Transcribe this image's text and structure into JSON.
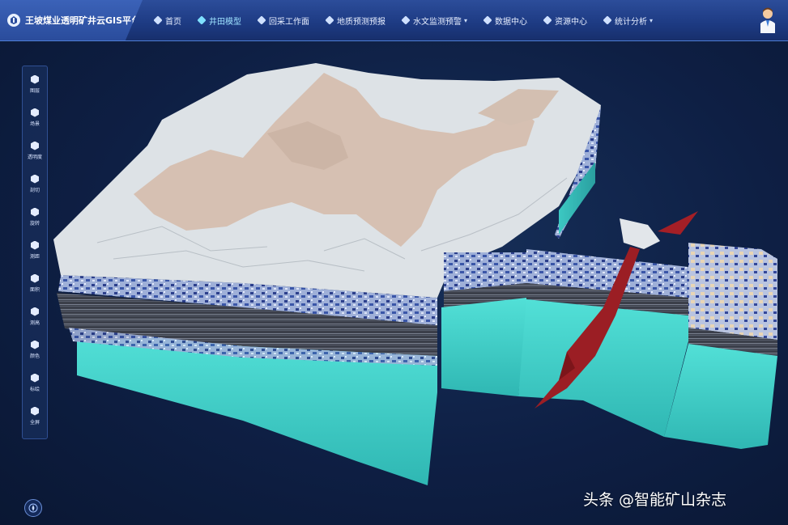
{
  "header": {
    "title": "王坡煤业透明矿井云GIS平台",
    "nav": [
      {
        "label": "首页",
        "active": false,
        "dropdown": false
      },
      {
        "label": "井田模型",
        "active": true,
        "dropdown": false
      },
      {
        "label": "回采工作面",
        "active": false,
        "dropdown": false
      },
      {
        "label": "地质预测预报",
        "active": false,
        "dropdown": false
      },
      {
        "label": "水文监测预警",
        "active": false,
        "dropdown": true
      },
      {
        "label": "数据中心",
        "active": false,
        "dropdown": false
      },
      {
        "label": "资源中心",
        "active": false,
        "dropdown": false
      },
      {
        "label": "统计分析",
        "active": false,
        "dropdown": true
      }
    ]
  },
  "toolbar": {
    "items": [
      {
        "label": "图层",
        "icon": "layers-icon"
      },
      {
        "label": "场景",
        "icon": "scene-icon"
      },
      {
        "label": "透明度",
        "icon": "transparency-icon"
      },
      {
        "label": "剖切",
        "icon": "section-cut-icon"
      },
      {
        "label": "旋转",
        "icon": "rotate-icon"
      },
      {
        "label": "测距",
        "icon": "distance-icon"
      },
      {
        "label": "面积",
        "icon": "area-icon"
      },
      {
        "label": "测高",
        "icon": "height-icon"
      },
      {
        "label": "颜色",
        "icon": "color-icon"
      },
      {
        "label": "标绘",
        "icon": "plot-icon"
      },
      {
        "label": "全屏",
        "icon": "fullscreen-icon"
      }
    ]
  },
  "watermark": "头条 @智能矿山杂志",
  "colors": {
    "header_bg": "#1d3a82",
    "active_nav": "#9fe3ff",
    "terrain_snow": "#dfe3e6",
    "terrain_rock": "#d7c2b4",
    "aquifer_cyan": "#3fd1c9",
    "fault_red": "#9b1e24"
  }
}
